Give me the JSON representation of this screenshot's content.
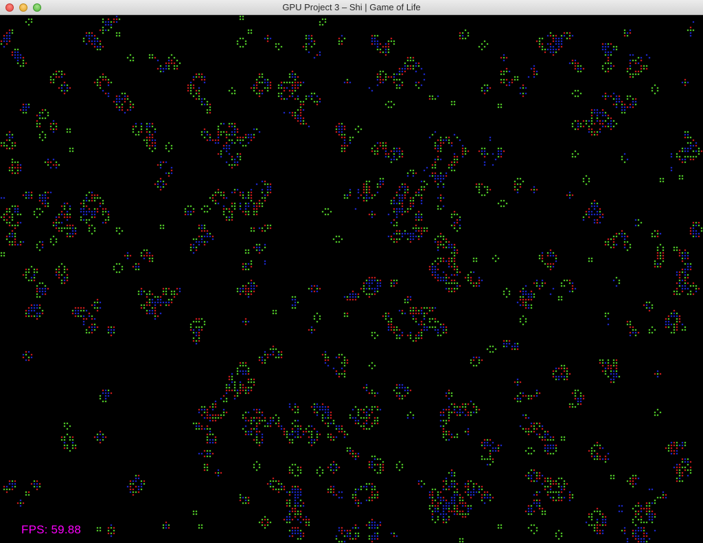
{
  "window": {
    "title": "GPU Project 3 – Shi | Game of Life"
  },
  "overlay": {
    "fps_text": "FPS: 59.88"
  },
  "colors": {
    "background": "#000000",
    "alive": "#66ff33",
    "born": "#ff2222",
    "dying": "#2233ff",
    "fps": "#ff00ff"
  },
  "icons": [
    "close-icon",
    "minimize-icon",
    "zoom-icon"
  ]
}
